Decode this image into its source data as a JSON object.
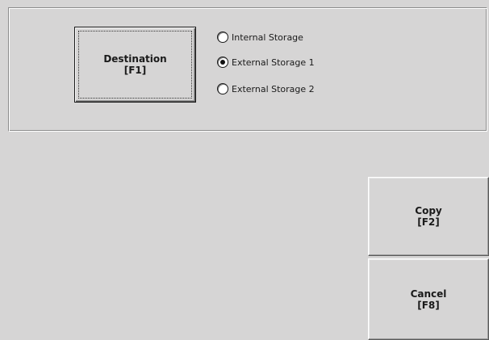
{
  "destination": {
    "button_line1": "Destination",
    "button_line2": "[F1]",
    "options": [
      {
        "label": "Internal Storage",
        "selected": false
      },
      {
        "label": "External Storage 1",
        "selected": true
      },
      {
        "label": "External Storage 2",
        "selected": false
      }
    ]
  },
  "actions": {
    "copy_line1": "Copy",
    "copy_line2": "[F2]",
    "cancel_line1": "Cancel",
    "cancel_line2": "[F8]"
  },
  "colors": {
    "background": "#d6d5d5",
    "text": "#1a1a1a"
  }
}
